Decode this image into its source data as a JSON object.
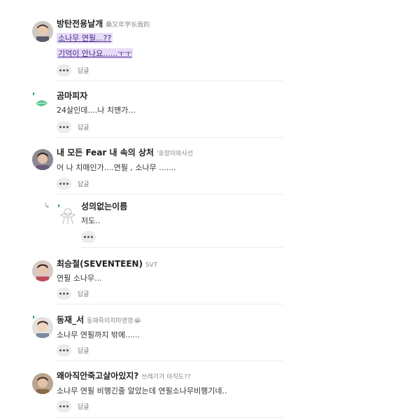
{
  "comments": [
    {
      "author": "방탄전용날개",
      "subtitle": "桑又年学长我的",
      "highlight_lines": [
        "소나무 연필...??",
        "기억이 안나요......ㅜㅜ"
      ],
      "reply_label": "답글",
      "avatar": "photo-avatar"
    },
    {
      "author": "곰마피자",
      "text": "24살인데....나 치맨가...",
      "reply_label": "답글",
      "avatar": "leaf-icon"
    },
    {
      "author": "내 모든 Fear 내 속의 상처",
      "subtitle": "'호랑이와사선",
      "text": "어 나 치매인가....연필 , 소나무 .......",
      "reply_label": "답글",
      "avatar": "photo-avatar"
    },
    {
      "author": "성의없는이름",
      "text": "저도..",
      "avatar": "sketch-avatar",
      "is_reply": true
    },
    {
      "author": "최승철(SEVENTEEN)",
      "subtitle": "SVT",
      "text": "연필 소나무...",
      "reply_label": "답글",
      "avatar": "photo-avatar"
    },
    {
      "author": "동재_서",
      "subtitle": "동재죽이지마영영",
      "emoji": "😭",
      "text": "소나무 연필까지 밖에......",
      "reply_label": "답글",
      "avatar": "photo-avatar"
    },
    {
      "author": "왜아직안죽고살아있지?",
      "subtitle": "쓰레기가 아직도??",
      "text": "소나무 연필 비행긴줄 알았는데 연필소나무비행기네..",
      "reply_label": "답글",
      "avatar": "photo-avatar"
    }
  ]
}
